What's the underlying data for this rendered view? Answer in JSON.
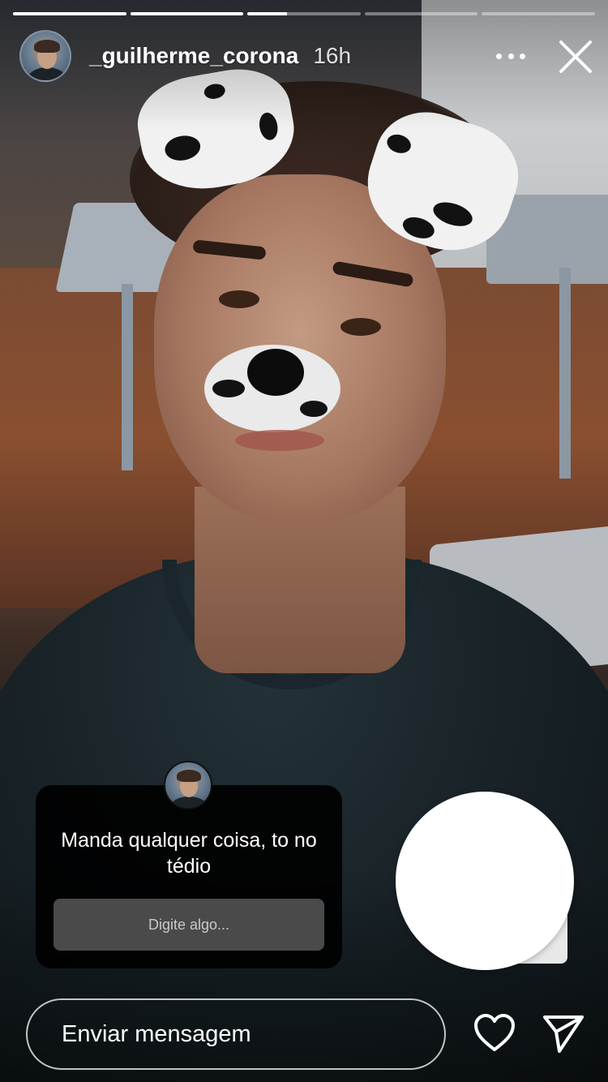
{
  "story": {
    "progress_segments": [
      1,
      1,
      0.35,
      0,
      0
    ],
    "username": "_guilherme_corona",
    "time_ago": "16h"
  },
  "header": {
    "more_icon": "more-horizontal-icon",
    "close_icon": "close-icon"
  },
  "question_sticker": {
    "prompt": "Manda qualquer coisa, to no tédio",
    "input_placeholder": "Digite algo..."
  },
  "reaction": {
    "emoji": "😍",
    "emoji_name": "heart-eyes-emoji"
  },
  "footer": {
    "message_placeholder": "Enviar mensagem",
    "like_icon": "heart-icon",
    "send_icon": "send-icon"
  },
  "colors": {
    "sticker_bg": "#000000",
    "sticker_input_bg": "#4a4a4a",
    "text": "#ffffff"
  }
}
